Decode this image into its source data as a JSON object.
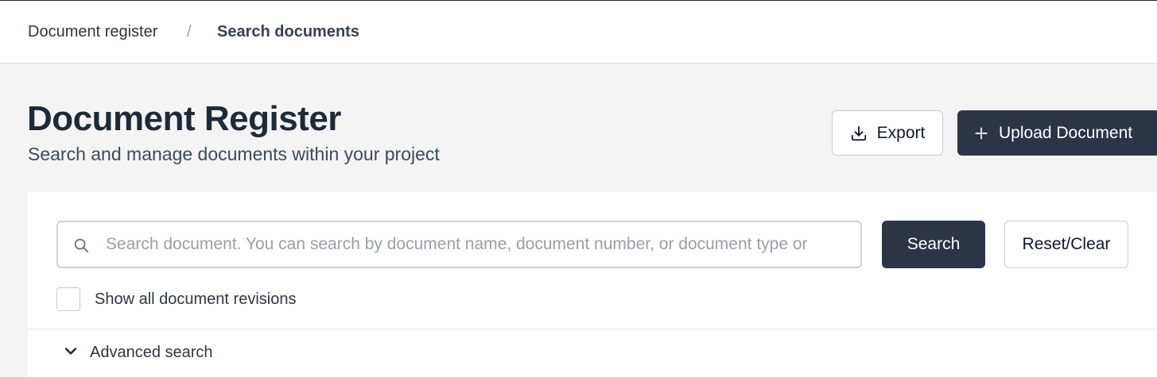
{
  "breadcrumb": {
    "items": [
      "Document register",
      "Search documents"
    ],
    "separator": "/"
  },
  "header": {
    "title": "Document Register",
    "subtitle": "Search and manage documents within your project"
  },
  "actions": {
    "export_label": "Export",
    "upload_label": "Upload Document"
  },
  "search": {
    "placeholder": "Search document. You can search by document name, document number, or document type or",
    "value": "",
    "search_label": "Search",
    "reset_label": "Reset/Clear"
  },
  "options": {
    "show_revisions_label": "Show all document revisions",
    "show_revisions_checked": false
  },
  "advanced": {
    "label": "Advanced search"
  },
  "colors": {
    "primary": "#2c3446",
    "background": "#f4f4f4",
    "border": "#c9ccd1"
  },
  "icons": {
    "search": "search-icon",
    "export": "download-icon",
    "upload": "plus-icon",
    "advanced": "chevron-down-icon"
  }
}
